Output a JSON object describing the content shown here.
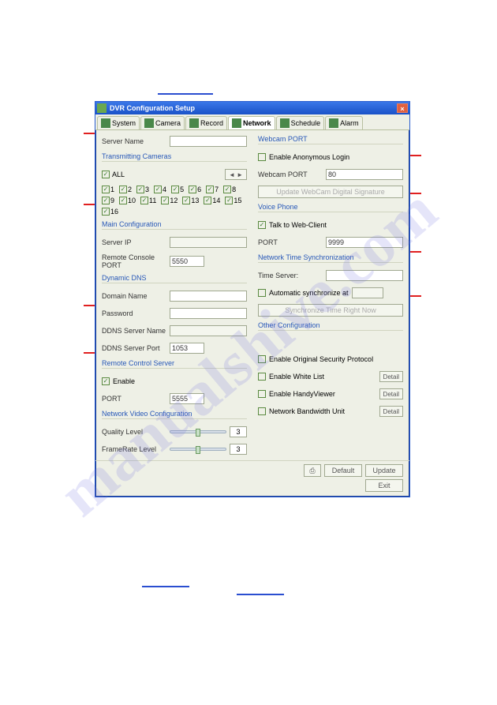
{
  "window_title": "DVR Configuration Setup",
  "tabs": [
    "System",
    "Camera",
    "Record",
    "Network",
    "Schedule",
    "Alarm"
  ],
  "active_tab": 3,
  "left": {
    "server_name_label": "Server Name",
    "server_name_value": "",
    "transmitting_label": "Transmitting Cameras",
    "all_label": "ALL",
    "cameras": [
      "1",
      "2",
      "3",
      "4",
      "5",
      "6",
      "7",
      "8",
      "9",
      "10",
      "11",
      "12",
      "13",
      "14",
      "15",
      "16"
    ],
    "main_cfg_label": "Main Configuration",
    "server_ip_label": "Server IP",
    "server_ip_value": "",
    "remote_console_label": "Remote Console PORT",
    "remote_console_value": "5550",
    "ddns_label": "Dynamic DNS",
    "domain_label": "Domain Name",
    "domain_value": "",
    "password_label": "Password",
    "password_value": "",
    "ddns_server_label": "DDNS Server Name",
    "ddns_server_value": "",
    "ddns_port_label": "DDNS Server Port",
    "ddns_port_value": "1053",
    "remote_ctrl_label": "Remote Control Server",
    "enable_label": "Enable",
    "rc_port_label": "PORT",
    "rc_port_value": "5555",
    "nvc_label": "Network Video Configuration",
    "quality_label": "Quality Level",
    "quality_value": "3",
    "framerate_label": "FrameRate Level",
    "framerate_value": "3"
  },
  "right": {
    "webcam_port_section": "Webcam PORT",
    "anon_login_label": "Enable Anonymous Login",
    "webcam_port_label": "Webcam PORT",
    "webcam_port_value": "80",
    "update_sig_btn": "Update WebCam Digital Signature",
    "voice_section": "Voice Phone",
    "talk_label": "Talk to Web-Client",
    "voice_port_label": "PORT",
    "voice_port_value": "9999",
    "time_sync_section": "Network Time Synchronization",
    "time_server_label": "Time Server:",
    "time_server_value": "",
    "auto_sync_label": "Automatic synchronize at",
    "sync_btn": "Synchronize Time Right Now",
    "other_section": "Other Configuration",
    "orig_sec_label": "Enable Original Security Protocol",
    "white_list_label": "Enable White List",
    "handyviewer_label": "Enable HandyViewer",
    "bandwidth_label": "Network Bandwidth Unit",
    "detail_btn": "Detail"
  },
  "footer": {
    "default_btn": "Default",
    "update_btn": "Update",
    "exit_btn": "Exit"
  },
  "watermark": "manualshive.com"
}
